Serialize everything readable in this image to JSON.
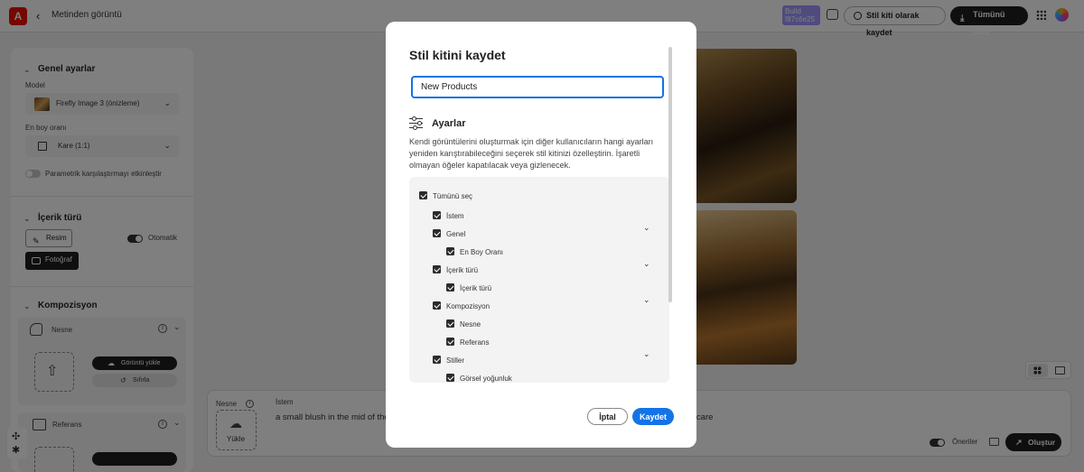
{
  "topbar": {
    "logo": "A",
    "back_icon": "chevron-left-icon",
    "back_label": "Metinden görüntü",
    "build_badge": "Build\nf87c6e25",
    "save_style_kit": "Stil kiti olarak kaydet",
    "download_all": "Tümünü indir"
  },
  "sidebar": {
    "general_title": "Genel ayarlar",
    "model_label": "Model",
    "model_value": "Firefly Image 3 (önizleme)",
    "aspect_label": "En boy oranı",
    "aspect_value": "Kare (1:1)",
    "param_toggle_label": "Parametrik karşılaştırmayı etkinleştir",
    "content_type_title": "İçerik türü",
    "content_image_btn": "Resim",
    "content_auto_label": "Otomatik",
    "content_photo_btn": "Fotoğraf",
    "composition_title": "Kompozisyon",
    "object_label": "Nesne",
    "upload_image_btn": "Görüntü yükle",
    "reset_btn": "Sıfırla",
    "reference_label": "Referans"
  },
  "prompt_bar": {
    "object_label": "Nesne",
    "prompt_label": "İstem",
    "upload_label": "Yükle",
    "prompt_text_left": "a small blush in the mid of the",
    "prompt_text_right": "d care",
    "suggestions_label": "Öneriler",
    "generate_btn": "Oluştur"
  },
  "modal": {
    "title": "Stil kitini kaydet",
    "name_value": "New Products",
    "settings_title": "Ayarlar",
    "description": "Kendi görüntülerini oluşturmak için diğer kullanıcıların hangi ayarları yeniden karıştırabileceğini seçerek stil kitinizi özelleştirin. İşaretli olmayan öğeler kapatılacak veya gizlenecek.",
    "select_all": "Tümünü seç",
    "items": {
      "prompt": "İstem",
      "general": "Genel",
      "aspect": "En Boy Oranı",
      "content_type": "İçerik türü",
      "content_type_sub": "İçerik türü",
      "composition": "Kompozisyon",
      "object": "Nesne",
      "reference": "Referans",
      "styles": "Stiller",
      "visual_intensity": "Görsel yoğunluk"
    },
    "cancel": "İptal",
    "save": "Kaydet"
  },
  "colors": {
    "accent_blue": "#1473e6",
    "adobe_red": "#eb1000",
    "build_badge": "#9f97ff",
    "dark_button": "#1e1e1e"
  }
}
